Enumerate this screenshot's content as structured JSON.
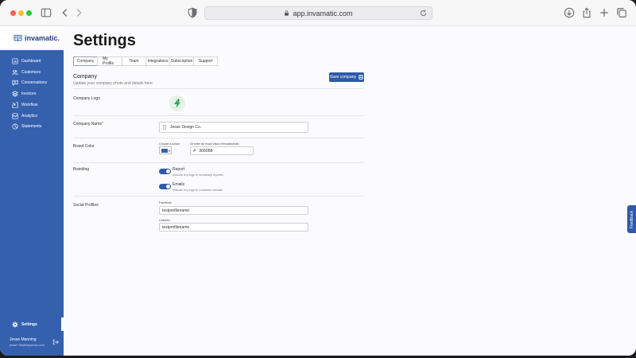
{
  "browser": {
    "url": "app.invamatic.com"
  },
  "app": {
    "name": "invamatic."
  },
  "sidebar": {
    "items": [
      {
        "label": "Dashboard",
        "icon": "dashboard-icon"
      },
      {
        "label": "Customers",
        "icon": "users-icon"
      },
      {
        "label": "Conversations",
        "icon": "chat-icon"
      },
      {
        "label": "Invoices",
        "icon": "layers-icon"
      },
      {
        "label": "Workflow",
        "icon": "workflow-icon"
      },
      {
        "label": "Analytics",
        "icon": "analytics-icon"
      },
      {
        "label": "Statements",
        "icon": "pie-chart-icon"
      }
    ],
    "settings_label": "Settings",
    "user": {
      "name": "Jesse Manning",
      "email": "jesse+46@skyshow.com"
    }
  },
  "page": {
    "title": "Settings",
    "tabs": [
      {
        "label": "Company",
        "active": true
      },
      {
        "label": "My Profile",
        "active": false
      },
      {
        "label": "Team",
        "active": false
      },
      {
        "label": "Integrations",
        "active": false
      },
      {
        "label": "Subscription",
        "active": false
      },
      {
        "label": "Support",
        "active": false
      }
    ],
    "section": {
      "title": "Company",
      "subtitle": "Update your company photo and details here",
      "save_label": "Save company"
    },
    "logo_row": {
      "label": "Company Logo"
    },
    "name_row": {
      "label": "Company Name",
      "required_mark": "*",
      "value": "Jesse Design Co."
    },
    "brand_row": {
      "label": "Brand Color",
      "choose_label": "Choose a colour",
      "hex_label": "Or enter an exact value (Hexadecimal)",
      "hex_prefix": "#",
      "hex_value": "3660B8",
      "color": "#3660b8"
    },
    "branding_row": {
      "label": "Branding",
      "toggles": [
        {
          "title": "Report",
          "desc": "Include my logo in summary reports.",
          "on": true
        },
        {
          "title": "Emails",
          "desc": "Include my logo in customer emails.",
          "on": true
        }
      ]
    },
    "social_row": {
      "label": "Social Profiles",
      "fields": [
        {
          "label": "Facebook",
          "value": "testprofilename"
        },
        {
          "label": "LinkedIn",
          "value": "testprofilename"
        }
      ]
    },
    "feedback_label": "Feedback"
  },
  "colors": {
    "sidebar": "#3560ae",
    "accent": "#2f5aa8"
  }
}
